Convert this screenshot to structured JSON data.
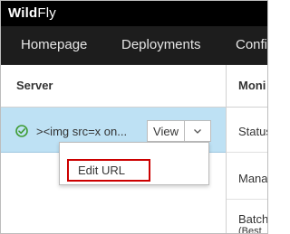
{
  "brand": {
    "bold": "Wild",
    "light": "Fly"
  },
  "nav": {
    "items": [
      {
        "label": "Homepage"
      },
      {
        "label": "Deployments"
      },
      {
        "label": "Confi"
      }
    ]
  },
  "server_column": {
    "header": "Server",
    "row": {
      "status_icon": "ok-circle-icon",
      "name": "><img src=x on...",
      "view_button": "View",
      "toggle_icon": "chevron-down-icon"
    }
  },
  "detail_column": {
    "header": "Moni",
    "items": [
      "Status",
      "Mana",
      "Batch",
      "(Best"
    ]
  },
  "dropdown": {
    "items": [
      {
        "label": "Edit URL"
      }
    ]
  },
  "colors": {
    "selected_row": "#bee1f4",
    "highlight": "#cc0000",
    "ok": "#3f9c35"
  }
}
